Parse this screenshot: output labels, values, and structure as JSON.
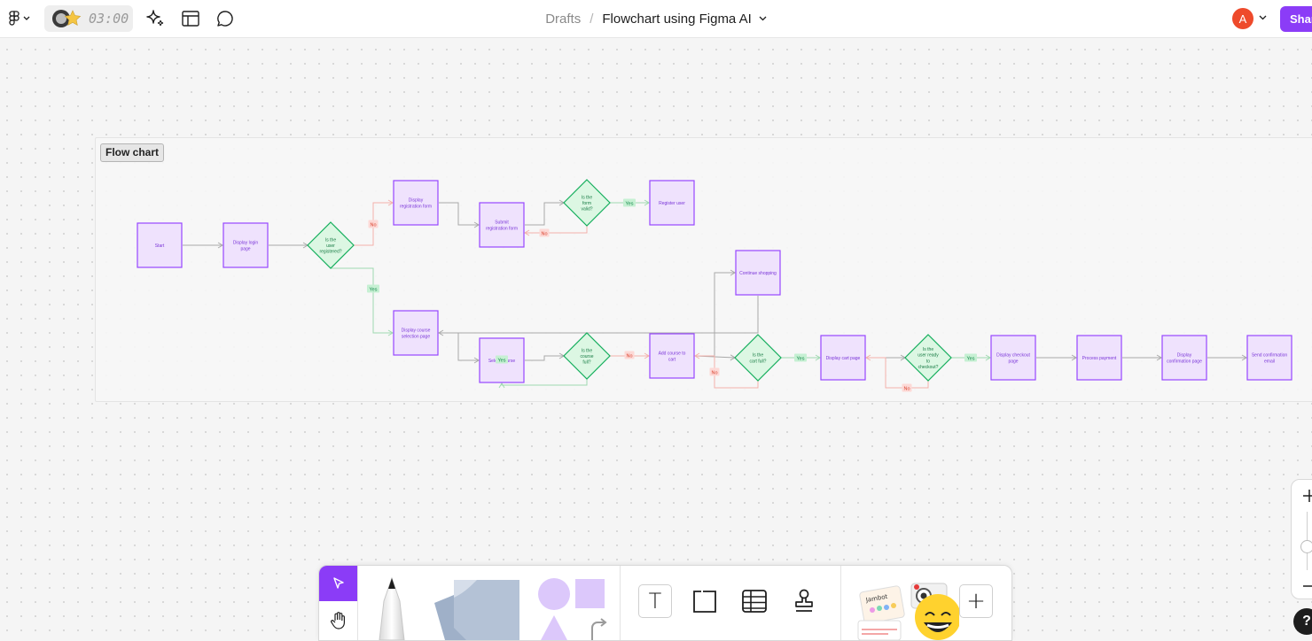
{
  "topbar": {
    "timer": "03:00",
    "breadcrumb_drafts": "Drafts",
    "breadcrumb_sep": "/",
    "file_title": "Flowchart using Figma AI",
    "avatar_letter": "A",
    "share_label": "Share"
  },
  "section": {
    "label": "Flow chart"
  },
  "flow": {
    "nodes": [
      {
        "id": "start",
        "shape": "rect",
        "text": "Start"
      },
      {
        "id": "login",
        "shape": "rect",
        "text": "Display login page"
      },
      {
        "id": "registered",
        "shape": "diamond",
        "text": "Is the user registered?"
      },
      {
        "id": "regform",
        "shape": "rect",
        "text": "Display registration form"
      },
      {
        "id": "submit",
        "shape": "rect",
        "text": "Submit registration form"
      },
      {
        "id": "valid",
        "shape": "diamond",
        "text": "Is the form valid?"
      },
      {
        "id": "register",
        "shape": "rect",
        "text": "Register user"
      },
      {
        "id": "courses",
        "shape": "rect",
        "text": "Display course selection page"
      },
      {
        "id": "select",
        "shape": "rect",
        "text": "Select course"
      },
      {
        "id": "full",
        "shape": "diamond",
        "text": "Is the course full?"
      },
      {
        "id": "addcart",
        "shape": "rect",
        "text": "Add course to cart"
      },
      {
        "id": "continue",
        "shape": "rect",
        "text": "Continue shopping"
      },
      {
        "id": "cartfull",
        "shape": "diamond",
        "text": "Is the cart full?"
      },
      {
        "id": "cartpage",
        "shape": "rect",
        "text": "Display cart page"
      },
      {
        "id": "ready",
        "shape": "diamond",
        "text": "Is the user ready to checkout?"
      },
      {
        "id": "checkout",
        "shape": "rect",
        "text": "Display checkout page"
      },
      {
        "id": "payment",
        "shape": "rect",
        "text": "Process payment"
      },
      {
        "id": "confirm",
        "shape": "rect",
        "text": "Display confirmation page"
      },
      {
        "id": "email",
        "shape": "rect",
        "text": "Send confirmation email"
      }
    ],
    "edges": [
      {
        "from": "start",
        "to": "login",
        "label": ""
      },
      {
        "from": "login",
        "to": "registered",
        "label": ""
      },
      {
        "from": "registered",
        "to": "regform",
        "label": "No",
        "kind": "no"
      },
      {
        "from": "registered",
        "to": "courses",
        "label": "Yes",
        "kind": "yes"
      },
      {
        "from": "regform",
        "to": "submit",
        "label": ""
      },
      {
        "from": "submit",
        "to": "valid",
        "label": ""
      },
      {
        "from": "valid",
        "to": "register",
        "label": "Yes",
        "kind": "yes"
      },
      {
        "from": "valid",
        "to": "submit",
        "label": "No",
        "kind": "no"
      },
      {
        "from": "courses",
        "to": "select",
        "label": ""
      },
      {
        "from": "select",
        "to": "full",
        "label": ""
      },
      {
        "from": "full",
        "to": "addcart",
        "label": "No",
        "kind": "no"
      },
      {
        "from": "full",
        "to": "select",
        "label": "Yes",
        "kind": "yes"
      },
      {
        "from": "addcart",
        "to": "continue",
        "label": ""
      },
      {
        "from": "continue",
        "to": "courses",
        "label": ""
      },
      {
        "from": "addcart",
        "to": "cartfull",
        "label": ""
      },
      {
        "from": "cartfull",
        "to": "addcart",
        "label": "No",
        "kind": "no"
      },
      {
        "from": "cartfull",
        "to": "cartpage",
        "label": "Yes",
        "kind": "yes"
      },
      {
        "from": "cartpage",
        "to": "ready",
        "label": ""
      },
      {
        "from": "ready",
        "to": "cartpage",
        "label": "No",
        "kind": "no"
      },
      {
        "from": "ready",
        "to": "checkout",
        "label": "Yes",
        "kind": "yes"
      },
      {
        "from": "checkout",
        "to": "payment",
        "label": ""
      },
      {
        "from": "payment",
        "to": "confirm",
        "label": ""
      },
      {
        "from": "confirm",
        "to": "email",
        "label": ""
      }
    ]
  },
  "toolbar": {
    "tools": [
      "move",
      "hand",
      "pencil",
      "sticky-note",
      "shapes",
      "text",
      "section",
      "table",
      "stamp",
      "widgets",
      "more"
    ],
    "widgets_label": "Jambot",
    "text_tool_glyph": "T",
    "more_glyph": "+"
  },
  "zoom": {
    "in_glyph": "+",
    "out_glyph": "–"
  },
  "help": {
    "glyph": "?"
  },
  "colors": {
    "accent": "#8b3cf7",
    "node_fill": "#efe2fd",
    "node_stroke": "#9747ff",
    "diamond_fill": "#dcf7e3",
    "diamond_stroke": "#14ae5c",
    "yes_bg": "#c6f0d3",
    "no_bg": "#fdd9d6"
  }
}
